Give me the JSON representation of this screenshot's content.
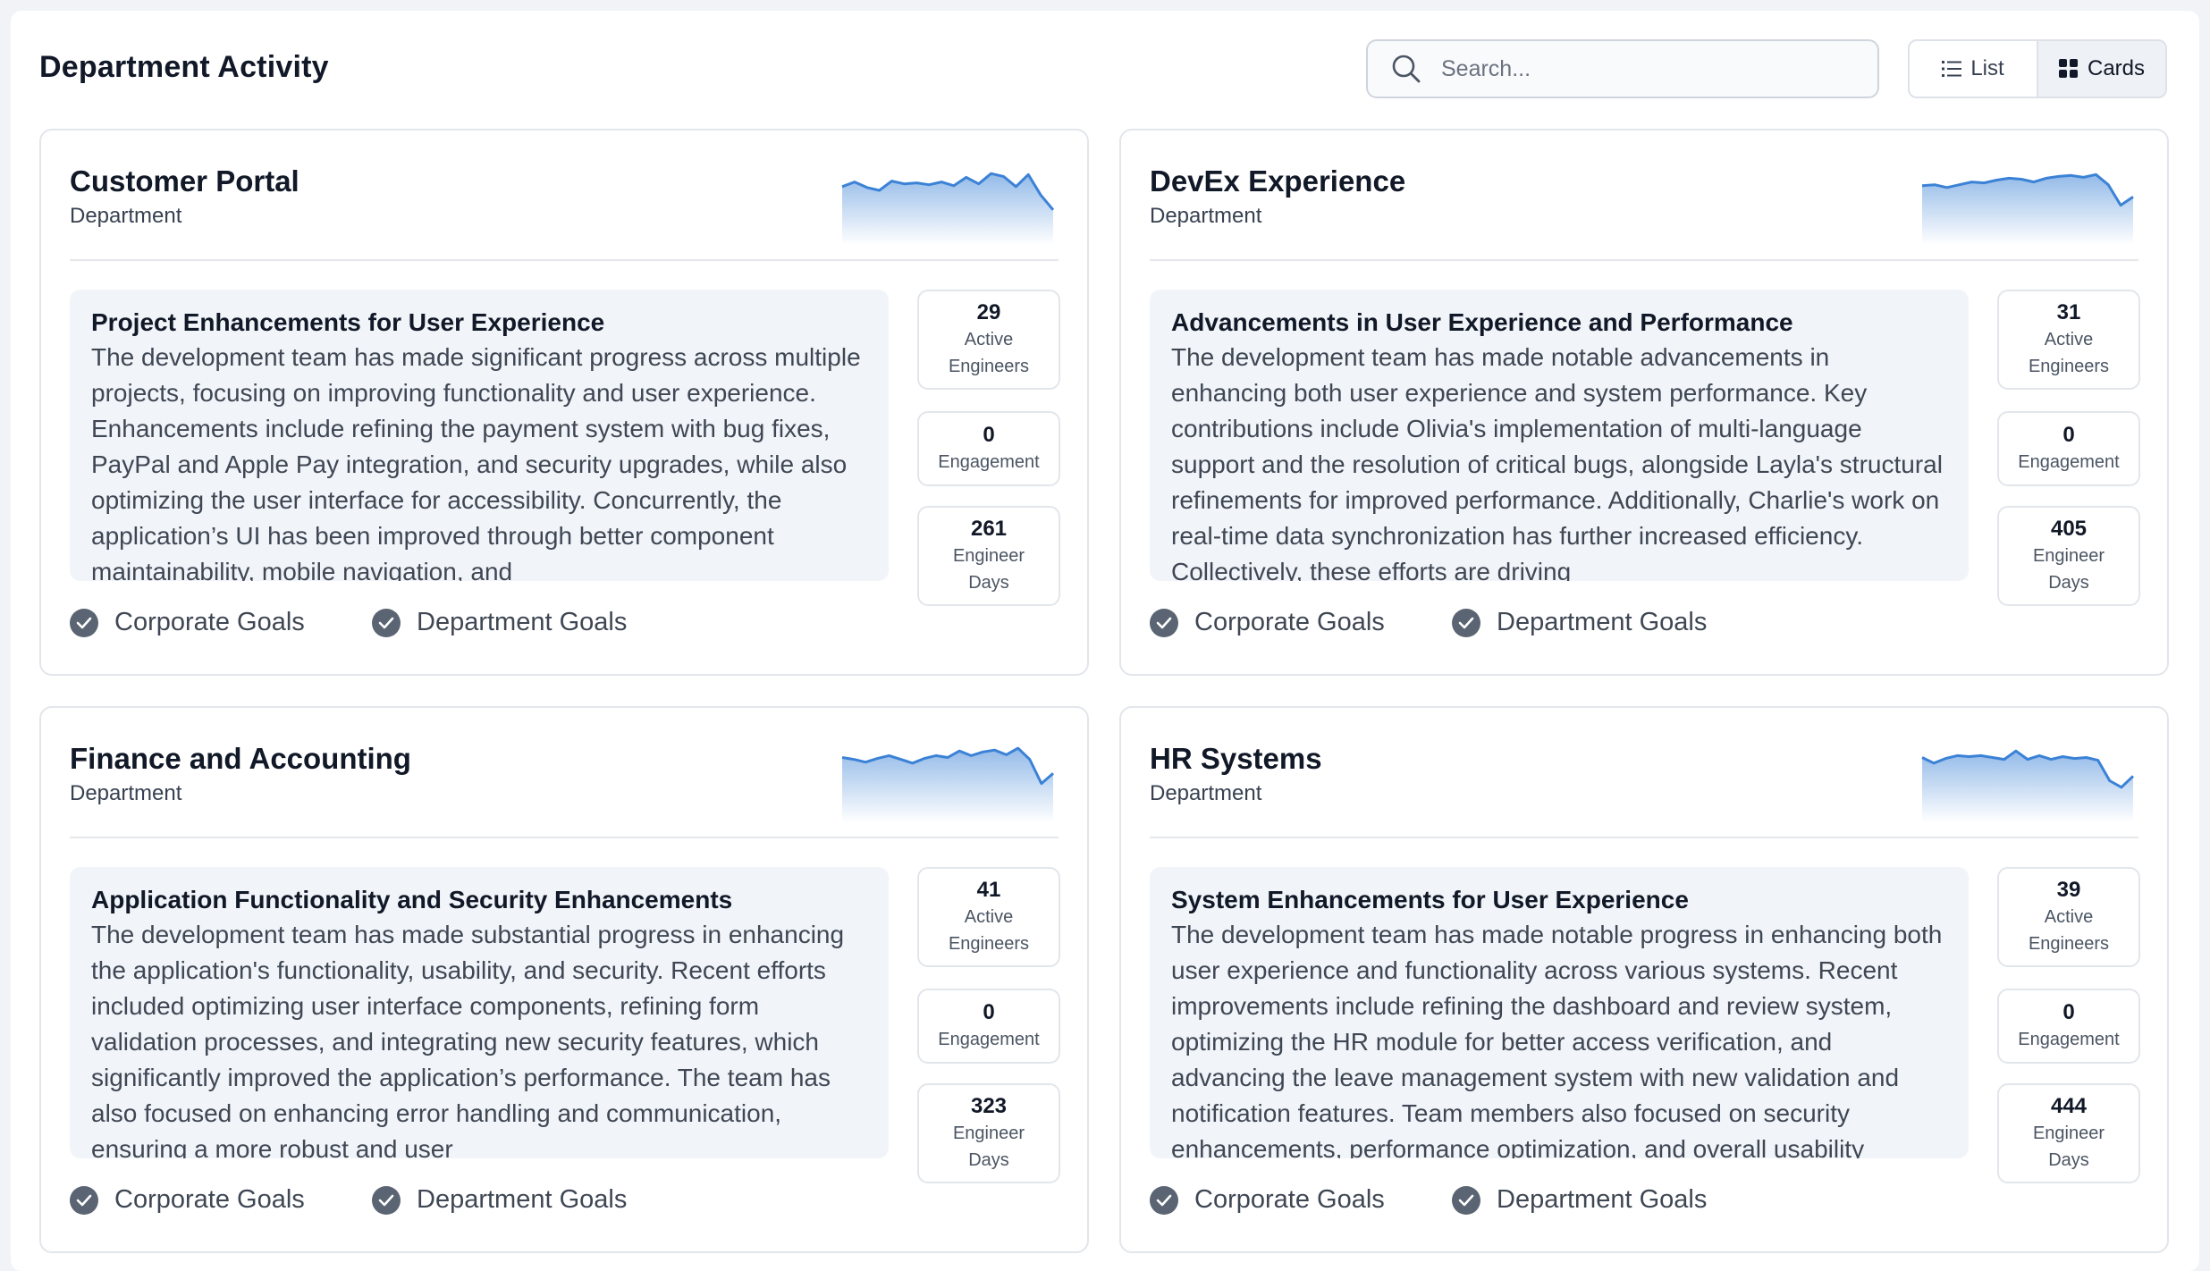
{
  "header": {
    "title": "Department Activity"
  },
  "search": {
    "placeholder": "Search..."
  },
  "view_toggle": {
    "list_label": "List",
    "cards_label": "Cards",
    "active": "Cards"
  },
  "colors": {
    "accent": "#3b82d6",
    "check": "#5b6472"
  },
  "cards": [
    {
      "title": "Customer Portal",
      "subtitle": "Department",
      "summary_title": "Project Enhancements for User Experience",
      "summary_body": "The development team has made significant progress across multiple projects, focusing on improving functionality and user experience. Enhancements include refining the payment system with bug fixes, PayPal and Apple Pay integration, and security upgrades, while also optimizing the user interface for accessibility. Concurrently, the application’s UI has been improved through better component maintainability, mobile navigation, and",
      "stats": [
        {
          "value": "29",
          "label": "Active Engineers"
        },
        {
          "value": "0",
          "label": "Engagement"
        },
        {
          "value": "261",
          "label": "Engineer Days"
        }
      ],
      "goals": [
        "Corporate Goals",
        "Department Goals"
      ],
      "sparkline": [
        0.4,
        0.3,
        0.42,
        0.48,
        0.28,
        0.34,
        0.32,
        0.36,
        0.3,
        0.38,
        0.2,
        0.34,
        0.12,
        0.18,
        0.4,
        0.14,
        0.58,
        0.9
      ]
    },
    {
      "title": "DevEx Experience",
      "subtitle": "Department",
      "summary_title": "Advancements in User Experience and Performance",
      "summary_body": "The development team has made notable advancements in enhancing both user experience and system performance. Key contributions include Olivia's implementation of multi-language support and the resolution of critical bugs, alongside Layla's structural refinements for improved performance. Additionally, Charlie's work on real-time data synchronization has further increased efficiency. Collectively, these efforts are driving",
      "stats": [
        {
          "value": "31",
          "label": "Active Engineers"
        },
        {
          "value": "0",
          "label": "Engagement"
        },
        {
          "value": "405",
          "label": "Engineer Days"
        }
      ],
      "goals": [
        "Corporate Goals",
        "Department Goals"
      ],
      "sparkline": [
        0.38,
        0.36,
        0.42,
        0.36,
        0.3,
        0.32,
        0.26,
        0.22,
        0.24,
        0.3,
        0.22,
        0.18,
        0.16,
        0.2,
        0.14,
        0.36,
        0.8,
        0.62
      ]
    },
    {
      "title": "Finance and Accounting",
      "subtitle": "Department",
      "summary_title": "Application Functionality and Security Enhancements",
      "summary_body": "The development team has made substantial progress in enhancing the application's functionality, usability, and security. Recent efforts included optimizing user interface components, refining form validation processes, and integrating new security features, which significantly improved the application’s performance. The team has also focused on enhancing error handling and communication, ensuring a more robust and user",
      "stats": [
        {
          "value": "41",
          "label": "Active Engineers"
        },
        {
          "value": "0",
          "label": "Engagement"
        },
        {
          "value": "323",
          "label": "Engineer Days"
        }
      ],
      "goals": [
        "Corporate Goals",
        "Department Goals"
      ],
      "sparkline": [
        0.26,
        0.3,
        0.36,
        0.28,
        0.22,
        0.3,
        0.38,
        0.28,
        0.22,
        0.26,
        0.12,
        0.22,
        0.14,
        0.1,
        0.2,
        0.06,
        0.3,
        0.82,
        0.6
      ]
    },
    {
      "title": "HR Systems",
      "subtitle": "Department",
      "summary_title": "System Enhancements for User Experience",
      "summary_body": "The development team has made notable progress in enhancing both user experience and functionality across various systems. Recent improvements include refining the dashboard and review system, optimizing the HR module for better access verification, and advancing the leave management system with new validation and notification features. Team members also focused on security enhancements, performance optimization, and overall usability",
      "stats": [
        {
          "value": "39",
          "label": "Active Engineers"
        },
        {
          "value": "0",
          "label": "Engagement"
        },
        {
          "value": "444",
          "label": "Engineer Days"
        }
      ],
      "goals": [
        "Corporate Goals",
        "Department Goals"
      ],
      "sparkline": [
        0.26,
        0.38,
        0.28,
        0.22,
        0.24,
        0.22,
        0.26,
        0.3,
        0.12,
        0.3,
        0.22,
        0.3,
        0.24,
        0.28,
        0.26,
        0.32,
        0.76,
        0.9,
        0.66
      ]
    }
  ]
}
